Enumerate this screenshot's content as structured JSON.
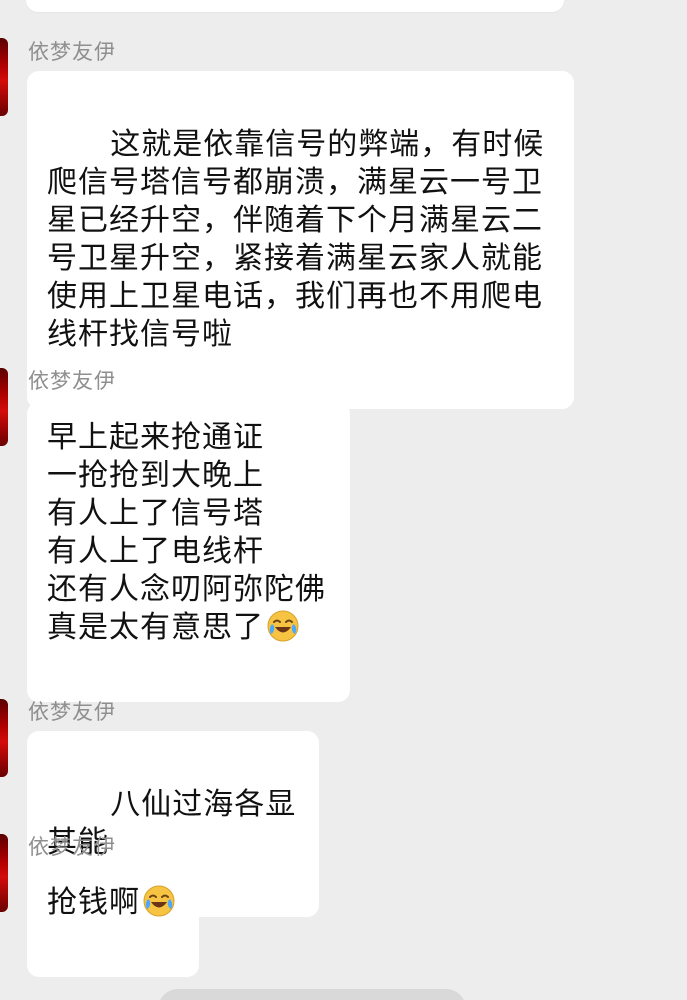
{
  "chat": {
    "messages": [
      {
        "sender": "依梦友伊",
        "text": "这就是依靠信号的弊端，有时候爬信号塔信号都崩溃，满星云一号卫星已经升空，伴随着下个月满星云二号卫星升空，紧接着满星云家人就能使用上卫星电话，我们再也不用爬电线杆找信号啦",
        "emoji": ""
      },
      {
        "sender": "依梦友伊",
        "text": "早上起来抢通证\n一抢抢到大晚上\n有人上了信号塔\n有人上了电线杆\n还有人念叨阿弥陀佛\n真是太有意思了",
        "emoji": "laughing-crying-emoji"
      },
      {
        "sender": "依梦友伊",
        "text": "八仙过海各显其能",
        "emoji": ""
      },
      {
        "sender": "依梦友伊",
        "text": "抢钱啊",
        "emoji": "laughing-crying-emoji"
      }
    ]
  },
  "colors": {
    "background": "#ededed",
    "bubble": "#ffffff",
    "sender_name": "#8f8f8f",
    "message_text": "#111111",
    "avatar_red": "#c00000"
  }
}
